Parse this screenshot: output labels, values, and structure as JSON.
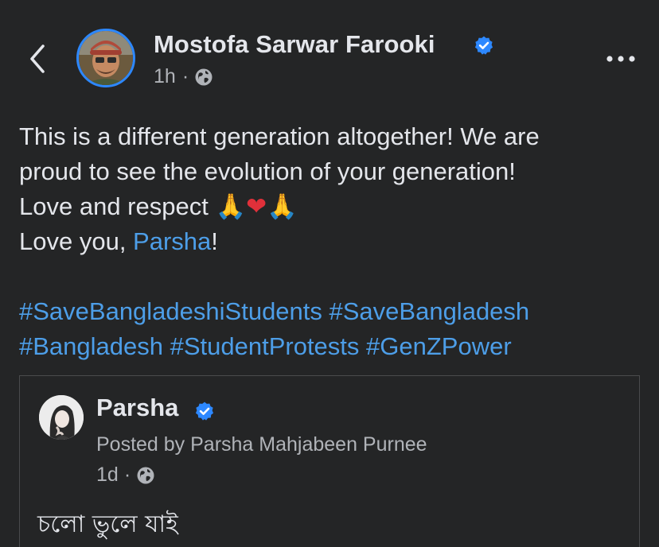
{
  "post": {
    "author": "Mostofa Sarwar Farooki",
    "time": "1h",
    "separator": "·",
    "text_lines": [
      "This is a different generation altogether! We are",
      "proud to see the evolution of your generation!",
      "Love and respect"
    ],
    "emojis": [
      "🙏",
      "❤",
      "🙏"
    ],
    "love_prefix": "Love you, ",
    "mention": "Parsha",
    "love_suffix": "!",
    "hashtags_line1": "#SaveBangladeshiStudents #SaveBangladesh",
    "hashtags_line2": "#Bangladesh #StudentProtests #GenZPower"
  },
  "shared": {
    "name": "Parsha",
    "posted_by": "Posted by Parsha Mahjabeen Purnee",
    "time": "1d",
    "separator": "·",
    "text": "চলো ভুলে যাই"
  },
  "icons": {
    "back": "chevron-left-icon",
    "verified": "verified-badge-icon",
    "globe": "globe-icon",
    "more": "more-horizontal-icon"
  },
  "colors": {
    "background": "#242526",
    "text": "#e4e6eb",
    "secondary": "#b0b3b8",
    "link": "#4d9ee8",
    "verified": "#2d88ff"
  }
}
